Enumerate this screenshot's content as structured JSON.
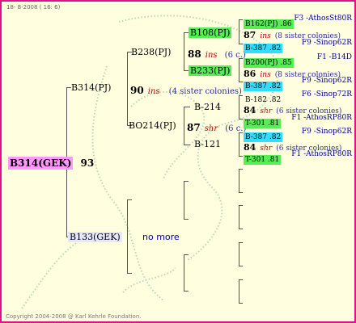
{
  "header": {
    "date_text": "18-  8-2008 ( 16:  6)"
  },
  "footer": {
    "copyright": "Copyright 2004-2008 @ Karl Kehrle Foundation."
  },
  "colors": {
    "border": "#e0108a",
    "background": "#ffffe0",
    "green_tag": "#55ee55",
    "cyan_tag": "#33ddff",
    "root_tag": "#ff99ff",
    "race": "#c00000"
  },
  "root": {
    "label": "B314(GEK)",
    "year": "93"
  },
  "gen1": {
    "upper": {
      "label": "B314(PJ)",
      "year": "90",
      "race": "ins",
      "sisters": "(4 sister colonies)"
    },
    "lower": {
      "label": "B133(GEK)",
      "note": "no more"
    }
  },
  "gen2": {
    "b238": {
      "label": "B238(PJ)"
    },
    "bo214": {
      "label": "BO214(PJ)",
      "year": "87",
      "race": "shr",
      "sisters": "(6 c.)"
    }
  },
  "gen3": {
    "b108": {
      "label": "B108(PJ)",
      "year": "88",
      "race": "ins",
      "sisters": "(6 c.)"
    },
    "b233": {
      "label": "B233(PJ)"
    },
    "b214": {
      "label": "B-214"
    },
    "b121": {
      "label": "B-121"
    }
  },
  "gen4": [
    {
      "tag": "B162(PJ) .86",
      "location": "F3 -AthosSt80R"
    },
    {
      "year": "87",
      "race": "ins",
      "sisters": "(8 sister colonies)"
    },
    {
      "tag": "B-387 .82",
      "location": "F9 -Sinop62R"
    },
    {
      "tag": "B200(PJ) .85",
      "location": "F1 -B14D"
    },
    {
      "year": "86",
      "race": "ins",
      "sisters": "(8 sister colonies)"
    },
    {
      "tag": "B-387 .82",
      "location": "F9 -Sinop62R"
    },
    {
      "tag": "B-182 .82",
      "location": "F6 -Sinop72R"
    },
    {
      "year": "84",
      "race": "shr",
      "sisters": "(6 sister colonies)"
    },
    {
      "tag": "T-301 .81",
      "location": "F1 -AthosRP80R"
    },
    {
      "tag": "B-387 .82",
      "location": "F9 -Sinop62R"
    },
    {
      "year": "84",
      "race": "shr",
      "sisters": "(6 sister colonies)"
    },
    {
      "tag": "T-301 .81",
      "location": "F1 -AthosRP80R"
    }
  ]
}
